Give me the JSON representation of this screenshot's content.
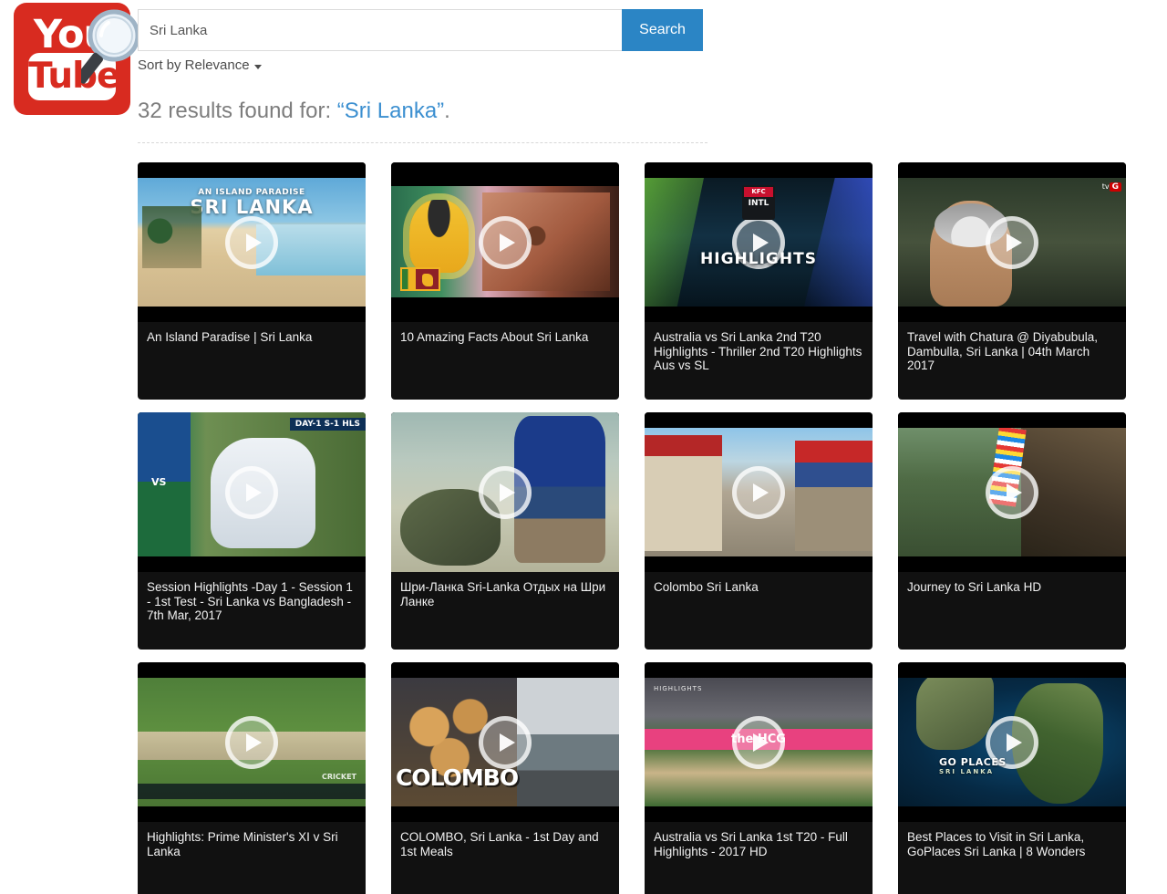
{
  "header": {
    "logo": {
      "line1": "You",
      "line2": "Tube",
      "icon": "magnifier-icon",
      "brand_color": "#d82b20"
    },
    "search": {
      "value": "Sri Lanka",
      "placeholder": "Search",
      "button_label": "Search",
      "button_color": "#2b85c5"
    },
    "sort": {
      "label": "Sort by Relevance",
      "caret_icon": "caret-down-icon"
    }
  },
  "results": {
    "count_text": "32 results found for: ",
    "query_text": "“Sri Lanka”",
    "trailing": ".",
    "query_color": "#3b8fd0"
  },
  "videos": [
    {
      "title": "An Island Paradise | Sri Lanka",
      "thumb_overlay_line1": "AN ISLAND PARADISE",
      "thumb_overlay_line2": "SRI LANKA",
      "play_icon": "play-circle-icon"
    },
    {
      "title": "10 Amazing Facts About Sri Lanka",
      "play_icon": "play-circle-icon"
    },
    {
      "title": "Australia vs Sri Lanka 2nd T20 Highlights - Thriller 2nd T20 Highlights Aus vs SL",
      "thumb_overlay_line1": "KFC",
      "thumb_overlay_line2": "INTL",
      "thumb_overlay_line3": "HIGHLIGHTS",
      "play_icon": "play-circle-icon"
    },
    {
      "title": "Travel with Chatura @ Diyabubula, Dambulla, Sri Lanka | 04th March 2017",
      "thumb_overlay_line1": "tv",
      "thumb_overlay_line2": "G",
      "play_icon": "play-circle-icon"
    },
    {
      "title": "Session Highlights -Day 1 - Session 1 - 1st Test - Sri Lanka vs Bangladesh - 7th Mar, 2017",
      "thumb_overlay_line1": "DAY-1 S-1 HLS",
      "thumb_overlay_line2": "VS",
      "play_icon": "play-circle-icon"
    },
    {
      "title": "Шри-Ланка Sri-Lanka Отдых на Шри Ланке",
      "play_icon": "play-circle-icon"
    },
    {
      "title": "Colombo Sri Lanka",
      "play_icon": "play-circle-icon"
    },
    {
      "title": "Journey to Sri Lanka HD",
      "play_icon": "play-circle-icon"
    },
    {
      "title": "Highlights: Prime Minister's XI v Sri Lanka",
      "thumb_overlay_line1": "CRICKET",
      "play_icon": "play-circle-icon"
    },
    {
      "title": "COLOMBO, Sri Lanka - 1st Day and 1st Meals",
      "thumb_overlay_line1": "COLOMBO",
      "play_icon": "play-circle-icon"
    },
    {
      "title": "Australia vs Sri Lanka 1st T20 - Full Highlights - 2017 HD",
      "thumb_overlay_line1": "HIGHLIGHTS",
      "thumb_overlay_line2": "the HCG",
      "play_icon": "play-circle-icon"
    },
    {
      "title": "Best Places to Visit in Sri Lanka, GoPlaces Sri Lanka | 8 Wonders",
      "thumb_overlay_line1": "GO PLACES",
      "thumb_overlay_line2": "SRI LANKA",
      "play_icon": "play-circle-icon"
    }
  ]
}
